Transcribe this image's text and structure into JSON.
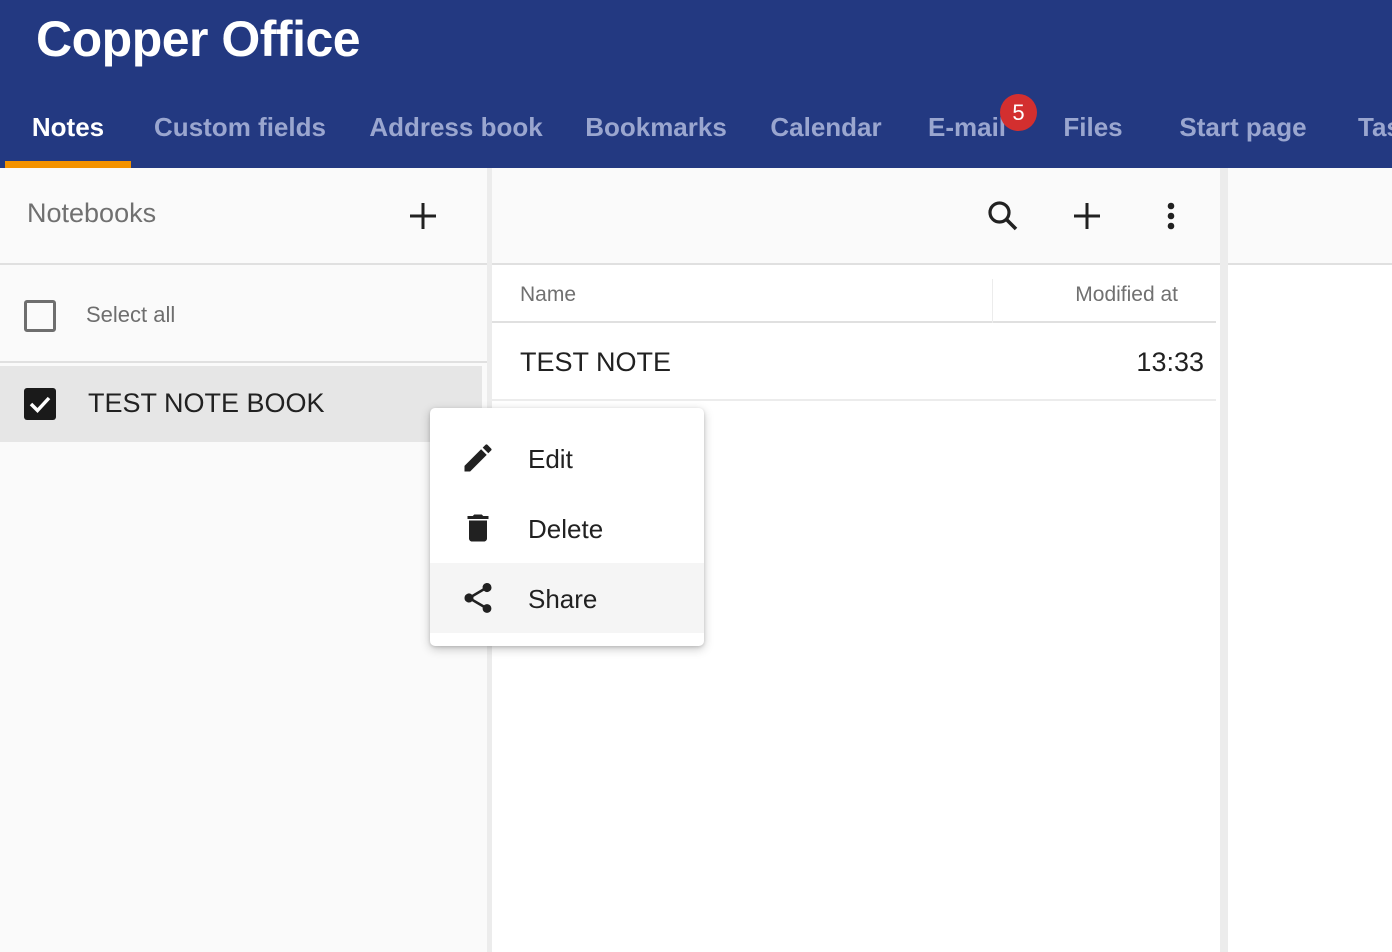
{
  "app": {
    "title": "Copper Office"
  },
  "tabs": [
    {
      "label": "Notes",
      "active": true
    },
    {
      "label": "Custom fields"
    },
    {
      "label": "Address book"
    },
    {
      "label": "Bookmarks"
    },
    {
      "label": "Calendar"
    },
    {
      "label": "E-mail",
      "badge": "5"
    },
    {
      "label": "Files"
    },
    {
      "label": "Start page"
    },
    {
      "label": "Tas"
    }
  ],
  "sidebar": {
    "title": "Notebooks",
    "select_all_label": "Select all",
    "select_all_checked": false,
    "notebooks": [
      {
        "label": "TEST NOTE BOOK",
        "checked": true
      }
    ]
  },
  "notes": {
    "columns": {
      "name": "Name",
      "modified": "Modified at"
    },
    "rows": [
      {
        "name": "TEST NOTE",
        "modified": "13:33"
      }
    ]
  },
  "context_menu": {
    "items": [
      {
        "label": "Edit",
        "icon": "pencil-icon"
      },
      {
        "label": "Delete",
        "icon": "trash-icon"
      },
      {
        "label": "Share",
        "icon": "share-icon",
        "hover": true
      }
    ]
  },
  "colors": {
    "header": "#233981",
    "tab_indicator": "#f39200",
    "badge": "#d32f2f"
  }
}
